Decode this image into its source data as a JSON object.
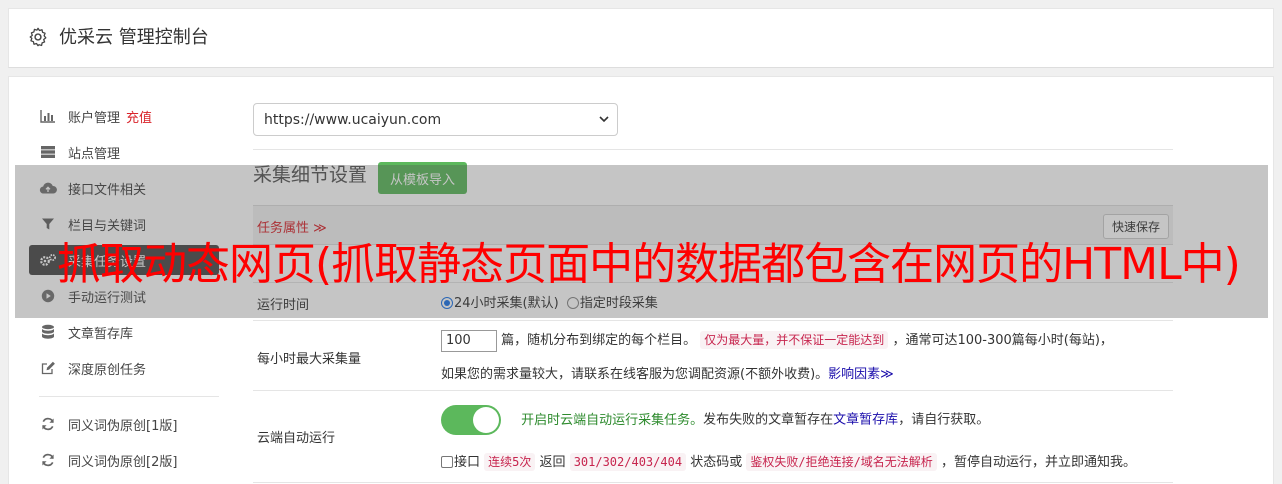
{
  "header": {
    "title": "优采云 管理控制台",
    "icon": "gear-icon"
  },
  "sidebar": {
    "items": [
      {
        "label": "账户管理",
        "badge": "充值",
        "icon": "bar-chart-icon"
      },
      {
        "label": "站点管理",
        "icon": "server-icon"
      },
      {
        "label": "接口文件相关",
        "icon": "cloud-upload-icon"
      },
      {
        "label": "栏目与关键词",
        "icon": "filter-icon"
      },
      {
        "label": "采集任务设置",
        "icon": "cogs-icon"
      },
      {
        "label": "手动运行测试",
        "icon": "play-circle-icon"
      },
      {
        "label": "文章暂存库",
        "icon": "database-icon"
      },
      {
        "label": "深度原创任务",
        "icon": "edit-icon"
      },
      {
        "label": "同义词伪原创[1版]",
        "icon": "refresh-icon"
      },
      {
        "label": "同义词伪原创[2版]",
        "icon": "refresh-icon"
      }
    ]
  },
  "main": {
    "site_select_value": "https://www.ucaiyun.com",
    "section_title": "采集细节设置",
    "import_button": "从模板导入",
    "task_props_label": "任务属性 ≫",
    "quick_save_button": "快速保存",
    "run_time": {
      "label": "运行时间",
      "option1": "24小时采集(默认)",
      "option2": "指定时段采集"
    },
    "max_per_hour": {
      "label": "每小时最大采集量",
      "value": "100",
      "text1": "篇，随机分布到绑定的每个栏目。",
      "code1": "仅为最大量，并不保证一定能达到",
      "text2": "，通常可达100-300篇每小时(每站)，",
      "text3": "如果您的需求量较大，请联系在线客服为您调配资源(不额外收费)。",
      "link": "影响因素≫"
    },
    "cloud_auto": {
      "label": "云端自动运行",
      "desc1": "开启时云端自动运行采集任务。",
      "desc2": "发布失败的文章暂存在",
      "desc_link": "文章暂存库",
      "desc3": "，请自行获取。",
      "chk_label": "接口",
      "code_a": "连续5次",
      "text_a": "返回",
      "code_b": "301/302/403/404",
      "text_b": "状态码或",
      "code_c": "鉴权失败/拒绝连接/域名无法解析",
      "text_c": "，暂停自动运行，并立即通知我。"
    }
  },
  "overlay": {
    "text": "抓取动态网页(抓取静态页面中的数据都包含在网页的HTML中)"
  },
  "colors": {
    "accent_green": "#5cb85c",
    "danger_red": "#d9232a",
    "overlay_red": "#ff0000"
  }
}
